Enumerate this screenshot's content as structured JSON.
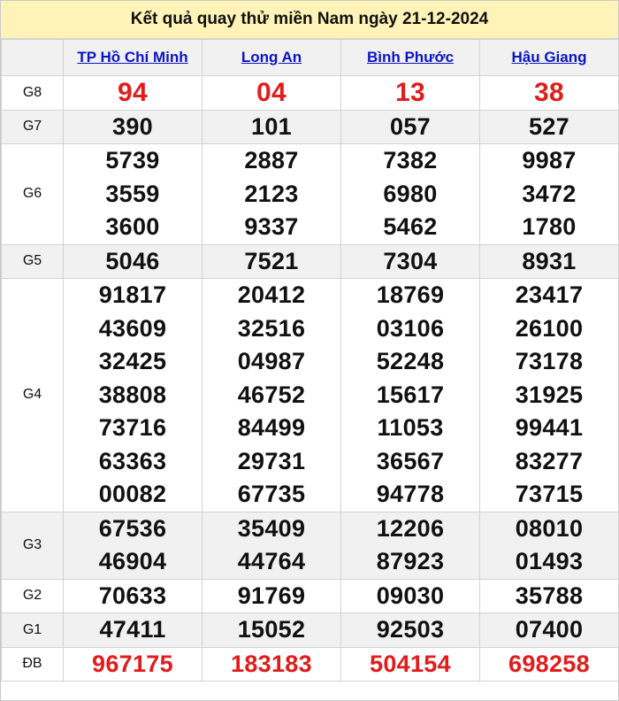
{
  "title": "Kết quả quay thử miền Nam ngày 21-12-2024",
  "provinces": [
    "TP Hồ Chí Minh",
    "Long An",
    "Bình Phước",
    "Hậu Giang"
  ],
  "prizes": [
    {
      "label": "G8",
      "results": [
        [
          "94"
        ],
        [
          "04"
        ],
        [
          "13"
        ],
        [
          "38"
        ]
      ],
      "highlight": true
    },
    {
      "label": "G7",
      "results": [
        [
          "390"
        ],
        [
          "101"
        ],
        [
          "057"
        ],
        [
          "527"
        ]
      ]
    },
    {
      "label": "G6",
      "results": [
        [
          "5739",
          "3559",
          "3600"
        ],
        [
          "2887",
          "2123",
          "9337"
        ],
        [
          "7382",
          "6980",
          "5462"
        ],
        [
          "9987",
          "3472",
          "1780"
        ]
      ]
    },
    {
      "label": "G5",
      "results": [
        [
          "5046"
        ],
        [
          "7521"
        ],
        [
          "7304"
        ],
        [
          "8931"
        ]
      ]
    },
    {
      "label": "G4",
      "results": [
        [
          "91817",
          "43609",
          "32425",
          "38808",
          "73716",
          "63363",
          "00082"
        ],
        [
          "20412",
          "32516",
          "04987",
          "46752",
          "84499",
          "29731",
          "67735"
        ],
        [
          "18769",
          "03106",
          "52248",
          "15617",
          "11053",
          "36567",
          "94778"
        ],
        [
          "23417",
          "26100",
          "73178",
          "31925",
          "99441",
          "83277",
          "73715"
        ]
      ]
    },
    {
      "label": "G3",
      "results": [
        [
          "67536",
          "46904"
        ],
        [
          "35409",
          "44764"
        ],
        [
          "12206",
          "87923"
        ],
        [
          "08010",
          "01493"
        ]
      ]
    },
    {
      "label": "G2",
      "results": [
        [
          "70633"
        ],
        [
          "91769"
        ],
        [
          "09030"
        ],
        [
          "35788"
        ]
      ]
    },
    {
      "label": "G1",
      "results": [
        [
          "47411"
        ],
        [
          "15052"
        ],
        [
          "92503"
        ],
        [
          "07400"
        ]
      ]
    },
    {
      "label": "ĐB",
      "results": [
        [
          "967175"
        ],
        [
          "183183"
        ],
        [
          "504154"
        ],
        [
          "698258"
        ]
      ],
      "highlight": true
    }
  ],
  "colors": {
    "header_bg": "#fff3b8",
    "highlight": "#e21b1b",
    "link": "#0b14c8",
    "row_shade": "#f1f1f1"
  }
}
